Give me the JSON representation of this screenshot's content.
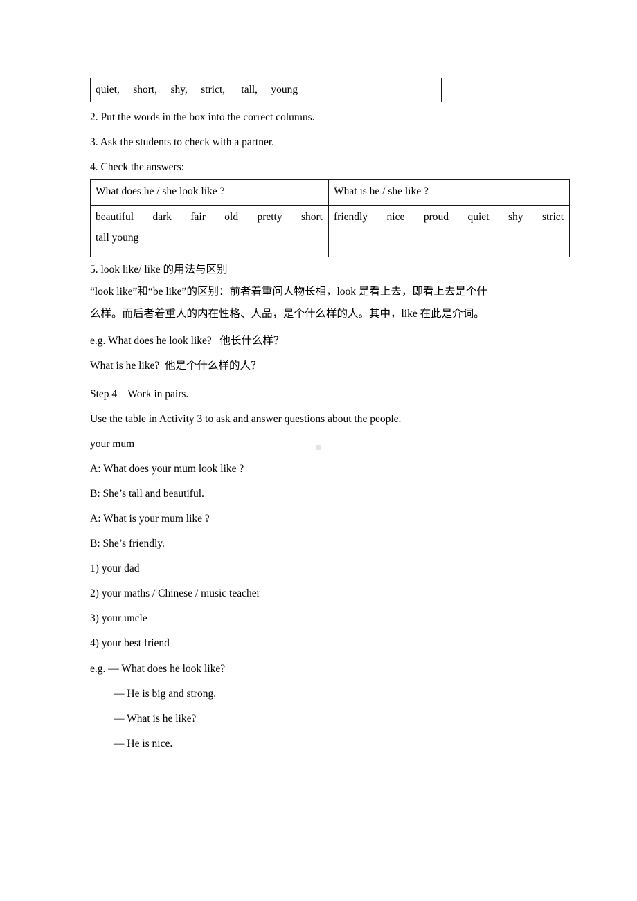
{
  "document": {
    "word_bank": {
      "words": [
        "quiet,",
        "short,",
        "shy,",
        "strict,",
        "tall,",
        "young"
      ],
      "text": "quiet,     short,     shy,     strict,      tall,     young"
    },
    "instructions": [
      {
        "id": "step2",
        "text": "2. Put the words in the box into the correct columns."
      },
      {
        "id": "step3",
        "text": "3. Ask the students to check with a partner."
      },
      {
        "id": "step4",
        "text": "4. Check the answers:"
      }
    ],
    "answers_table": {
      "headers": [
        "What does he / she look like ?",
        "What is he / she like ?"
      ],
      "cells": [
        {
          "lines": [
            "beautiful dark fair old pretty short",
            "tall    young"
          ],
          "words": [
            "beautiful",
            "dark",
            "fair",
            "old",
            "pretty",
            "short",
            "tall",
            "young"
          ]
        },
        {
          "lines": [
            "friendly nice proud quiet shy strict"
          ],
          "words": [
            "friendly",
            "nice",
            "proud",
            "quiet",
            "shy",
            "strict"
          ]
        }
      ]
    },
    "grammar": {
      "heading": "5. look like/ like 的用法与区别",
      "explanation_line1": "“look like”和“be like”的区别：前者着重问人物长相，look 是看上去，即看上去是个什",
      "explanation_line2": "么样。而后者着重人的内在性格、人品，是个什么样的人。其中，like 在此是介词。",
      "example1": "e.g. What does he look like?   他长什么样？",
      "example2": "What is he like?  他是个什么样的人？"
    },
    "step4": {
      "title": "Step 4    Work in pairs.",
      "directions": "Use the table in Activity 3 to ask and answer questions about the people.",
      "sample_topic": "your mum",
      "dialogue": [
        "A: What does your mum look like ?",
        "B: She’s tall and beautiful.",
        "A: What is your mum like ?",
        "B: She’s friendly."
      ],
      "practice_items": [
        "1) your dad",
        "2) your maths / Chinese / music teacher",
        "3) your uncle",
        "4) your best friend"
      ],
      "example_dialogue": {
        "prompt": "e.g. — What does he look like?",
        "replies": [
          "— He is big and strong.",
          "— What is he like?",
          "— He is nice."
        ]
      }
    }
  }
}
